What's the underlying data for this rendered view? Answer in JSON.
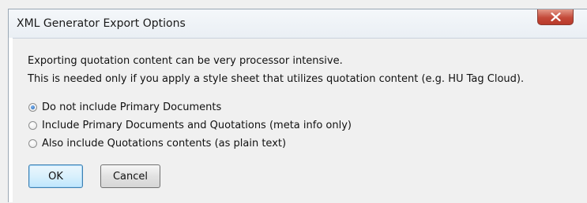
{
  "dialog": {
    "title": "XML Generator Export Options",
    "close_label": "X",
    "message_line_1": "Exporting quotation content can be very processor intensive.",
    "message_line_2": "This is needed only if you apply a style sheet that utilizes quotation content (e.g. HU Tag Cloud).",
    "options": [
      {
        "label": "Do not include Primary Documents",
        "checked": true
      },
      {
        "label": "Include Primary Documents and Quotations (meta info only)",
        "checked": false
      },
      {
        "label": "Also include Quotations contents (as plain text)",
        "checked": false
      }
    ],
    "buttons": {
      "ok_label": "OK",
      "cancel_label": "Cancel"
    }
  },
  "colors": {
    "close_button": "#c44a3a",
    "selected_radio": "#1e5fb0",
    "default_button_border": "#3c7fb1"
  }
}
